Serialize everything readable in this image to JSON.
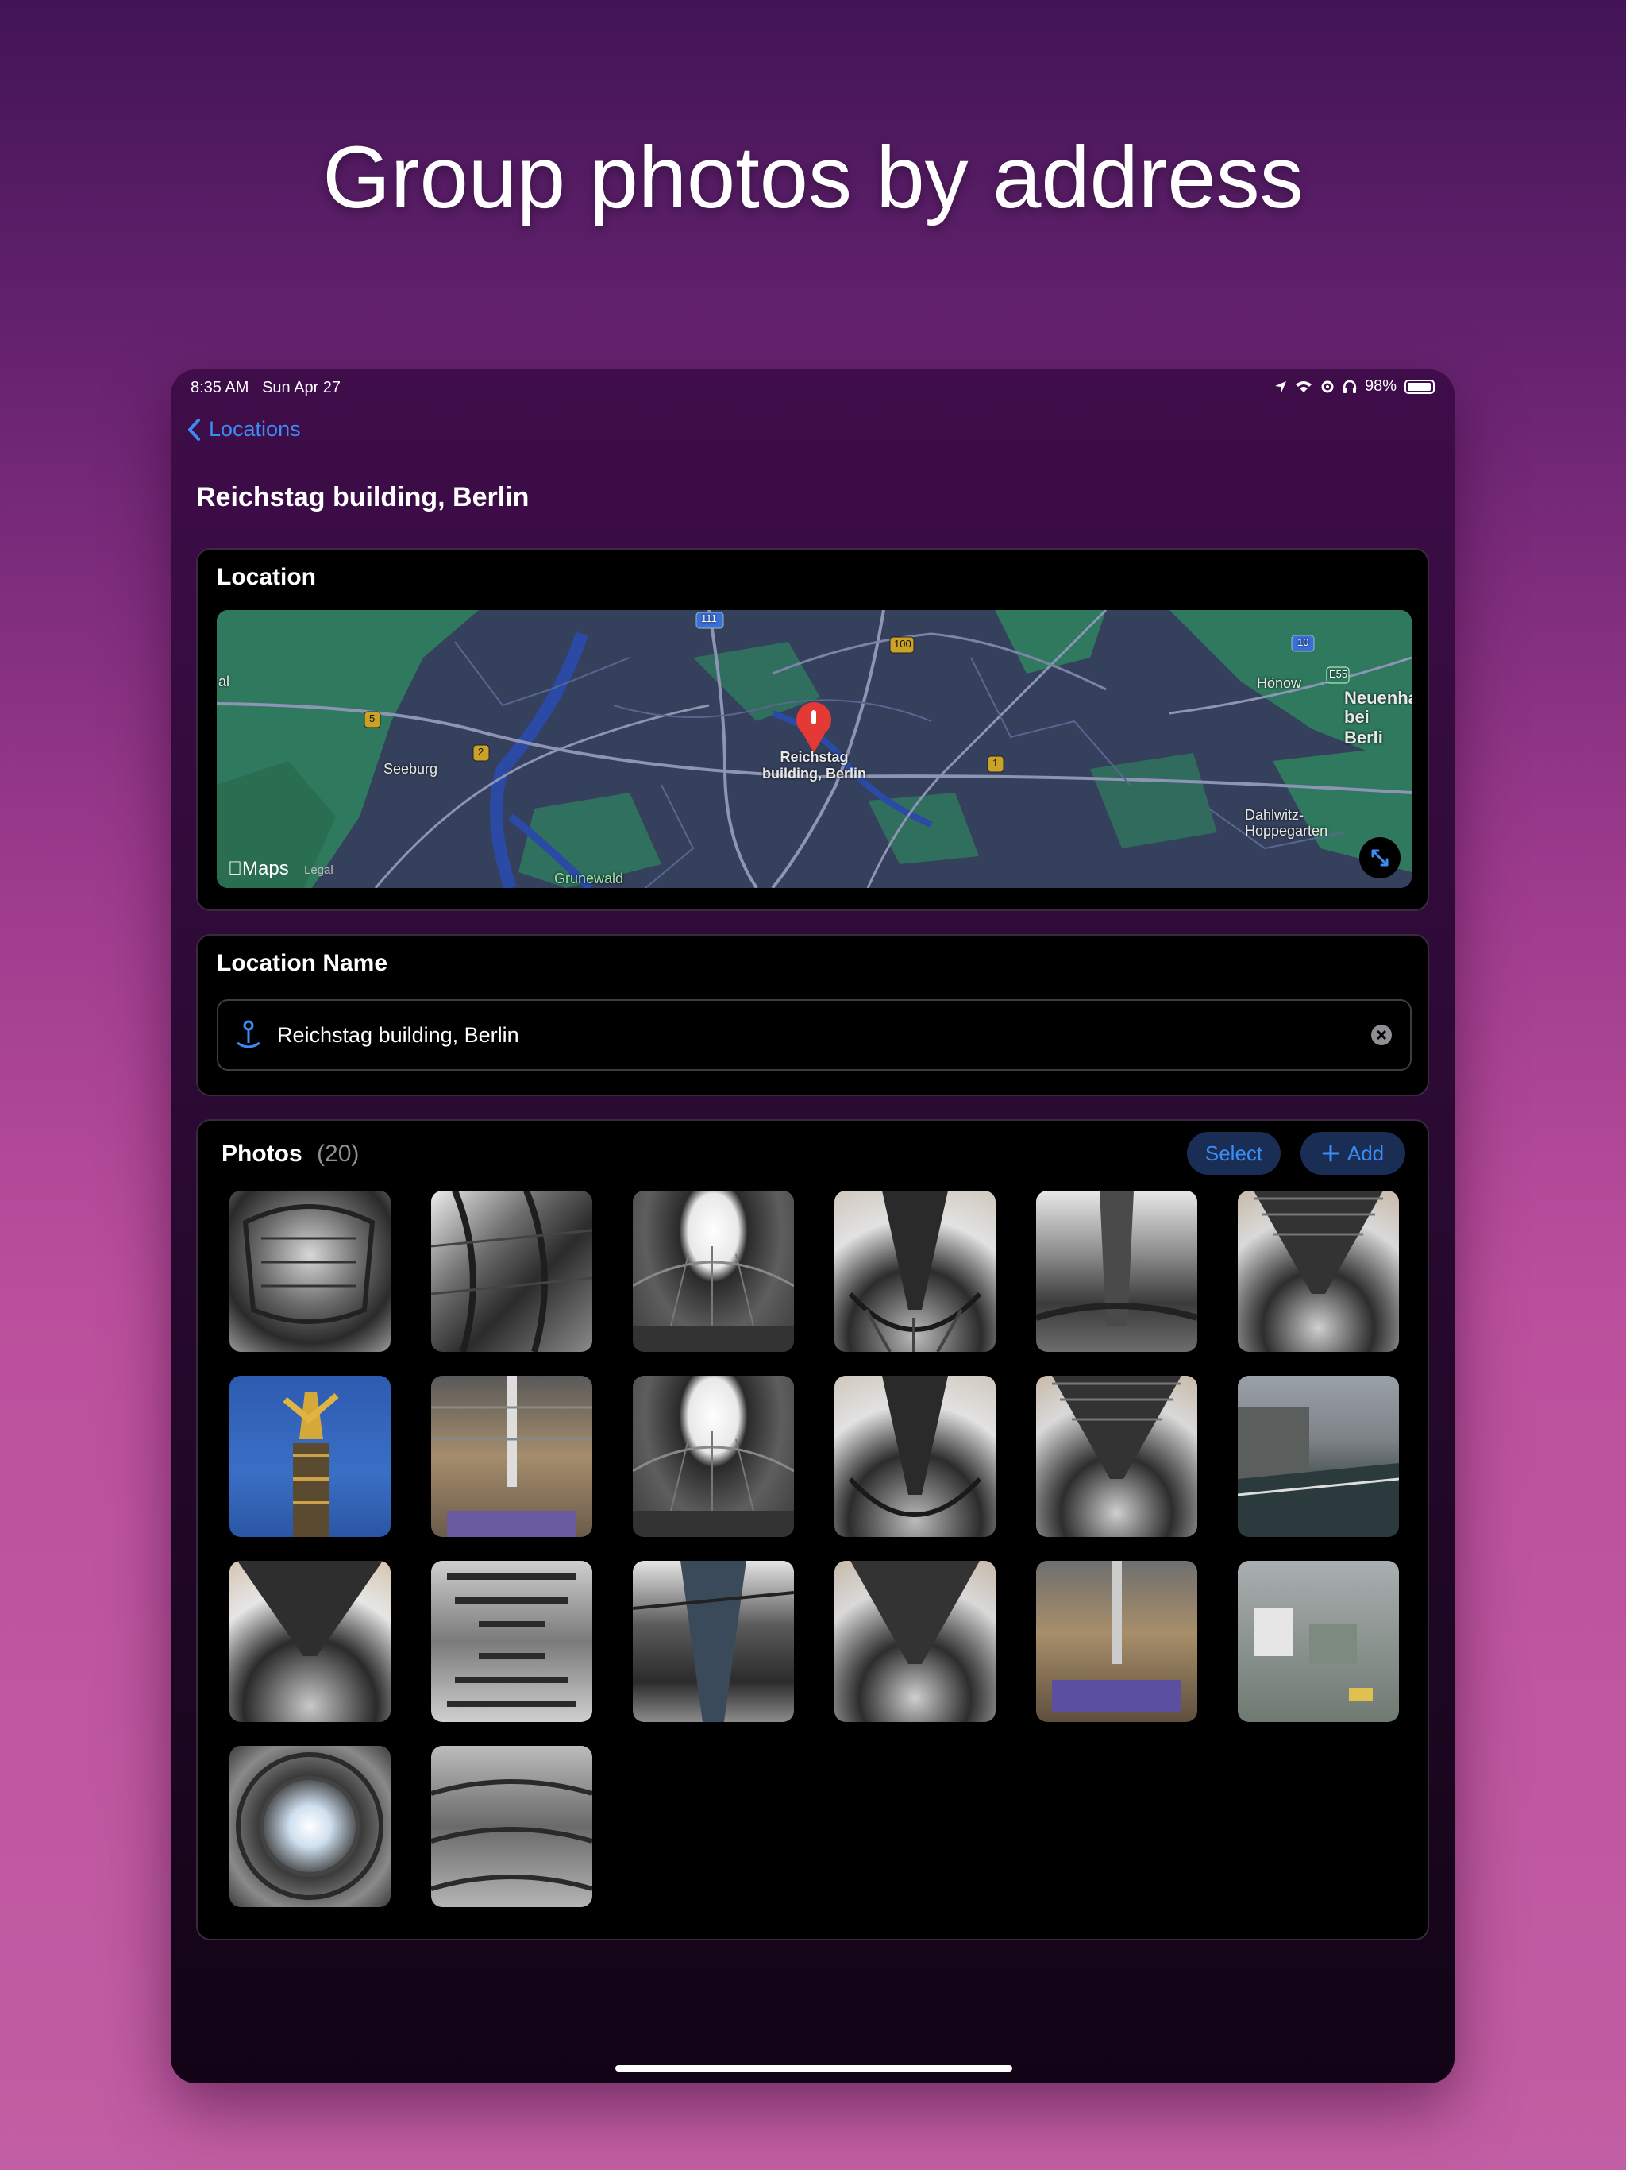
{
  "headline": "Group photos by address",
  "status_bar": {
    "time": "8:35 AM",
    "date": "Sun Apr 27",
    "battery": "98%"
  },
  "nav": {
    "back_label": "Locations"
  },
  "page_title": "Reichstag building, Berlin",
  "location_card": {
    "title": "Location",
    "pin_label_line1": "Reichstag",
    "pin_label_line2": "building, Berlin",
    "place_labels": [
      "Seeburg",
      "Hönow",
      "Neuenha",
      "bei Berli",
      "Dahlwitz-",
      "Hoppegarten",
      "Grunewald",
      "al"
    ],
    "road_badges": [
      "111",
      "100",
      "10",
      "E55",
      "5",
      "2",
      "1"
    ],
    "maps_logo": "Maps",
    "legal": "Legal"
  },
  "location_name_card": {
    "title": "Location Name",
    "value": "Reichstag building, Berlin"
  },
  "photos_card": {
    "title": "Photos",
    "count": "(20)",
    "select_label": "Select",
    "add_label": "Add",
    "thumbnails": [
      "dome-ramp",
      "dome-ramp-wide",
      "dome-skylight",
      "mirror-cone",
      "dome-interior",
      "mirror-cone",
      "victory-column",
      "plenary-hall",
      "dome-skylight",
      "mirror-cone",
      "mirror-cone",
      "rooftop-terrace",
      "mirror-cone",
      "mirror-cone-vertical",
      "dome-ramp",
      "mirror-cone",
      "plenary-hall",
      "city-view",
      "dome-oculus",
      "dome-ramp-people"
    ]
  },
  "colors": {
    "accent": "#3b8cf5",
    "map_park": "#2f7a5e",
    "map_water": "#2a4aa6",
    "pin": "#e53935"
  }
}
